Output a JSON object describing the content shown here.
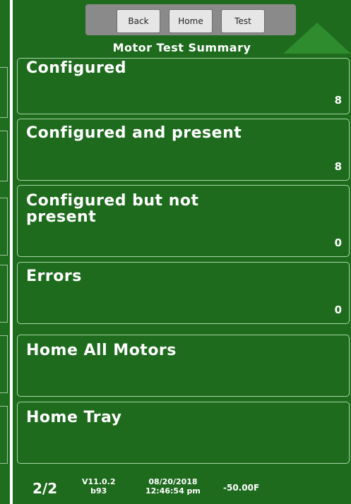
{
  "nav": {
    "back": "Back",
    "home": "Home",
    "test": "Test"
  },
  "title": "Motor Test Summary",
  "items": [
    {
      "label": "Configured",
      "value": "8"
    },
    {
      "label": "Configured and present",
      "value": "8"
    },
    {
      "label": "Configured but not present",
      "value": "0"
    },
    {
      "label": "Errors",
      "value": "0"
    },
    {
      "label": "Home All Motors",
      "value": ""
    },
    {
      "label": "Home Tray",
      "value": ""
    }
  ],
  "footer": {
    "page": "2/2",
    "version": "V11.0.2",
    "build": "b93",
    "date": "08/20/2018",
    "time": "12:46:54 pm",
    "temperature": "-50.00F"
  },
  "colors": {
    "panel": "#1e6b1e",
    "card_border": "#a6d6a6",
    "text": "#ffffff",
    "arrow": "#2e8b2e"
  },
  "icons": {
    "scroll_up": "up-triangle-icon"
  }
}
